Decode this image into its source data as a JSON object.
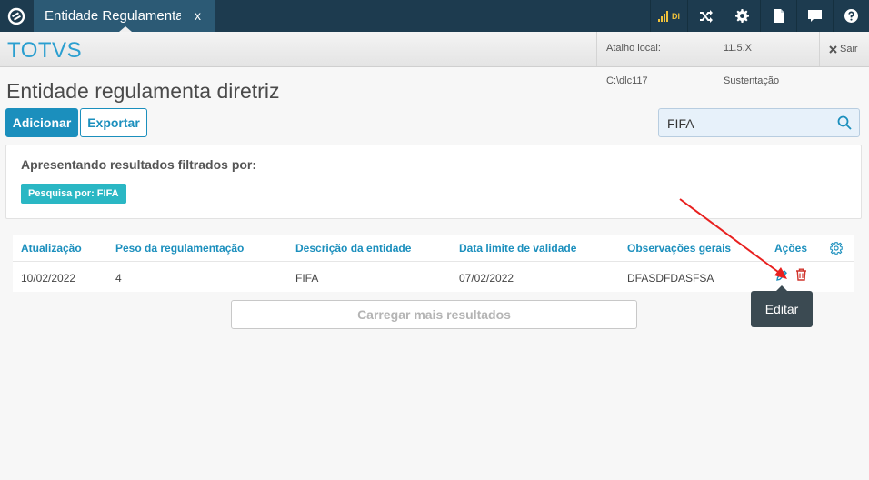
{
  "topbar": {
    "tab_label": "Entidade Regulamenta",
    "tab_close": "x",
    "signal_label": "Dl",
    "icons": [
      "totvs-logo-icon",
      "signal-icon",
      "shuffle-icon",
      "gear-icon",
      "document-icon",
      "chat-icon",
      "help-icon"
    ],
    "background": "#1d3b4f",
    "tab_background": "#2c5a75"
  },
  "header": {
    "brand": "TOTVS",
    "local_shortcut": "Atalho local: C:\\dlc117",
    "version": "11.5.X Sustentação",
    "exit_label": "Sair",
    "brand_color": "#2b9fd0"
  },
  "page": {
    "title": "Entidade regulamenta diretriz",
    "add_button": "Adicionar",
    "export_button": "Exportar",
    "search_value": "FIFA",
    "accent_color": "#1b8fbd"
  },
  "filter": {
    "title": "Apresentando resultados filtrados por:",
    "tag": "Pesquisa por: FIFA",
    "tag_color": "#2ab7c4"
  },
  "table": {
    "headers": [
      "Atualização",
      "Peso da regulamentação",
      "Descrição da entidade",
      "Data limite de validade",
      "Observações gerais",
      "Ações"
    ],
    "rows": [
      [
        "10/02/2022",
        "4",
        "FIFA",
        "07/02/2022",
        "DFASDFDASFSA"
      ]
    ]
  },
  "load_more": "Carregar mais resultados",
  "tooltip": "Editar"
}
